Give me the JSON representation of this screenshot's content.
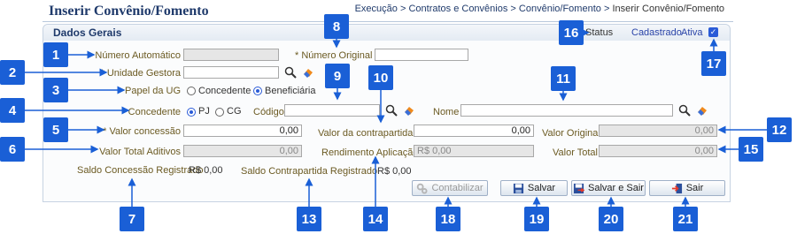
{
  "header": {
    "title": "Inserir Convênio/Fomento",
    "breadcrumb": [
      "Execução",
      "Contratos e Convênios",
      "Convênio/Fomento",
      "Inserir Convênio/Fomento"
    ],
    "sep": ">"
  },
  "section_title": "Dados Gerais",
  "status": {
    "label": "Status",
    "value_a": "Cadastrado",
    "value_b": "Ativa",
    "ativa_checked": true
  },
  "form": {
    "numero_automatico": {
      "label": "Número Automático",
      "value": ""
    },
    "numero_original": {
      "label": "* Número Original",
      "value": ""
    },
    "unidade_gestora": {
      "label": "* Unidade Gestora",
      "value": ""
    },
    "papel_ug": {
      "label": "Papel da UG",
      "options": [
        "Concedente",
        "Beneficiária"
      ],
      "selected": "Beneficiária"
    },
    "concedente": {
      "label": "Concedente",
      "options": [
        "PJ",
        "CG"
      ],
      "selected": "PJ"
    },
    "codigo": {
      "label": "Código",
      "value": ""
    },
    "nome": {
      "label": "Nome",
      "value": ""
    },
    "valor_concessao": {
      "label": "* Valor concessão",
      "value": "0,00"
    },
    "valor_contrapartida": {
      "label": "Valor da contrapartida",
      "value": "0,00"
    },
    "valor_original": {
      "label": "Valor Original",
      "value": "0,00"
    },
    "valor_total_aditivos": {
      "label": "Valor Total Aditivos",
      "value": "0,00"
    },
    "rendimento_aplicacao": {
      "label": "Rendimento Aplicação",
      "value": "R$ 0,00"
    },
    "valor_total": {
      "label": "Valor Total",
      "value": "0,00"
    },
    "saldo_concessao": {
      "label": "Saldo Concessão Registrado",
      "value": "R$ 0,00"
    },
    "saldo_contrapartida": {
      "label": "Saldo Contrapartida Registrado",
      "value": "R$ 0,00"
    }
  },
  "buttons": {
    "contabilizar": "Contabilizar",
    "salvar": "Salvar",
    "salvar_sair": "Salvar e Sair",
    "sair": "Sair"
  },
  "callouts": [
    "1",
    "2",
    "3",
    "4",
    "5",
    "6",
    "7",
    "8",
    "9",
    "10",
    "11",
    "12",
    "13",
    "14",
    "15",
    "16",
    "17",
    "18",
    "19",
    "20",
    "21"
  ],
  "colors": {
    "badge": "#1a5fd6",
    "title": "#1f3a6b",
    "label_olive": "#6b5a22",
    "status_blue": "#2a44a8"
  }
}
